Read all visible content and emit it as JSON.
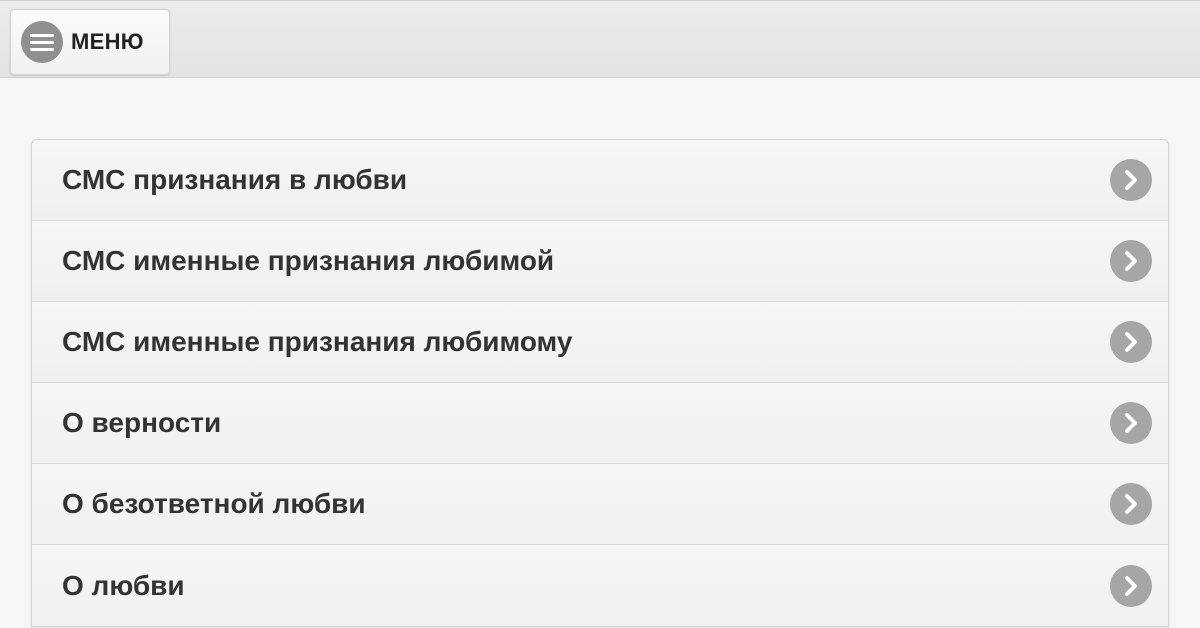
{
  "header": {
    "menu_label": "МЕНЮ",
    "menu_icon": "hamburger-menu-icon"
  },
  "list": {
    "chevron_icon": "chevron-right-icon",
    "items": [
      {
        "label": "СМС признания в любви"
      },
      {
        "label": "СМС именные признания любимой"
      },
      {
        "label": "СМС именные признания любимому"
      },
      {
        "label": "О верности"
      },
      {
        "label": "О безответной любви"
      },
      {
        "label": "О любви"
      }
    ]
  },
  "colors": {
    "background": "#f7f7f7",
    "topbar": "#e8e8e8",
    "icon_circle": "#a6a6a6",
    "text": "#333333"
  }
}
